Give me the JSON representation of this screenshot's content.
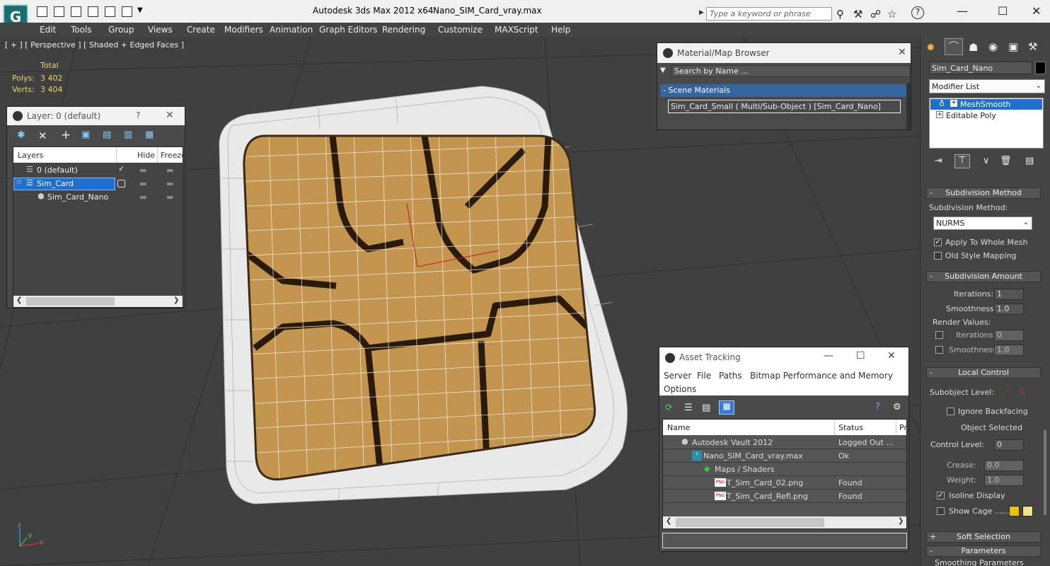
{
  "window": {
    "app_title": "Autodesk 3ds Max  2012 x64",
    "file_title": "Nano_SIM_Card_vray.max",
    "search_placeholder": "Type a keyword or phrase"
  },
  "menu": [
    "Edit",
    "Tools",
    "Group",
    "Views",
    "Create",
    "Modifiers",
    "Animation",
    "Graph Editors",
    "Rendering",
    "Customize",
    "MAXScript",
    "Help"
  ],
  "viewport": {
    "label": "[ + ] [ Perspective ] [ Shaded + Edged Faces ]",
    "stats": {
      "header": "Total",
      "polys_label": "Polys:",
      "polys_value": "3 402",
      "verts_label": "Verts:",
      "verts_value": "3 404"
    },
    "axis": {
      "z": "z",
      "y": "y",
      "x": "x"
    }
  },
  "layer_panel": {
    "title": "Layer: 0 (default)",
    "help": "?",
    "columns": [
      "Layers",
      "Hide",
      "Freeze"
    ],
    "rows": [
      {
        "name": "0 (default)"
      },
      {
        "name": "Sim_Card"
      },
      {
        "name": "Sim_Card_Nano"
      }
    ]
  },
  "material_browser": {
    "title": "Material/Map Browser",
    "search_placeholder": "Search by Name ...",
    "group": "Scene Materials",
    "item": "Sim_Card_Small  ( Multi/Sub-Object )  [Sim_Card_Nano]"
  },
  "asset_tracking": {
    "title": "Asset Tracking",
    "menu": [
      "Server",
      "File",
      "Paths",
      "Bitmap Performance and Memory",
      "Options"
    ],
    "columns": [
      "Name",
      "Status",
      "Pr"
    ],
    "rows": [
      {
        "name": "Autodesk Vault 2012",
        "status": "Logged Out ..."
      },
      {
        "name": "Nano_SIM_Card_vray.max",
        "status": "Ok"
      },
      {
        "name": "Maps / Shaders",
        "status": ""
      },
      {
        "name": "T_Sim_Card_02.png",
        "status": "Found"
      },
      {
        "name": "T_Sim_Card_Refl.png",
        "status": "Found"
      }
    ],
    "png_badge": "PNG"
  },
  "command_panel": {
    "object_name": "Sim_Card_Nano",
    "modifier_list": "Modifier List",
    "stack": [
      "MeshSmooth",
      "Editable Poly"
    ],
    "subdivision_method": {
      "title": "Subdivision Method",
      "label": "Subdivision Method:",
      "value": "NURMS",
      "apply_whole_mesh": "Apply To Whole Mesh",
      "old_style_mapping": "Old Style Mapping"
    },
    "subdivision_amount": {
      "title": "Subdivision Amount",
      "iterations_label": "Iterations:",
      "iterations": "1",
      "smoothness_label": "Smoothness:",
      "smoothness": "1.0",
      "render_values": "Render Values:",
      "r_iterations_label": "Iterations:",
      "r_iterations": "0",
      "r_smoothness_label": "Smoothness:",
      "r_smoothness": "1.0"
    },
    "local_control": {
      "title": "Local Control",
      "subobject_label": "Subobject Level:",
      "ignore_backfacing": "Ignore Backfacing",
      "object_selected": "Object Selected",
      "control_level_label": "Control Level:",
      "control_level": "0",
      "crease_label": "Crease:",
      "crease": "0.0",
      "weight_label": "Weight:",
      "weight": "1.0",
      "isoline_display": "Isoline Display",
      "show_cage": "Show Cage ......"
    },
    "soft_selection": "Soft Selection",
    "parameters": "Parameters",
    "smoothing_parameters": "Smoothing Parameters"
  },
  "colors": {
    "cage1": "#f0c000",
    "cage2": "#f0e08a",
    "chip": "#c4954f",
    "selection": "#1f6fcf"
  }
}
